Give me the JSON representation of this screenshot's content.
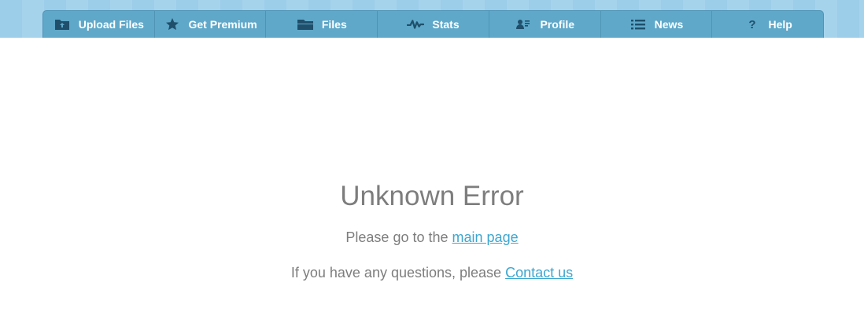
{
  "nav": {
    "items": [
      {
        "label": "Upload Files",
        "icon": "upload-folder-icon"
      },
      {
        "label": "Get Premium",
        "icon": "star-icon"
      },
      {
        "label": "Files",
        "icon": "folder-icon"
      },
      {
        "label": "Stats",
        "icon": "stats-wave-icon"
      },
      {
        "label": "Profile",
        "icon": "profile-card-icon"
      },
      {
        "label": "News",
        "icon": "list-icon"
      },
      {
        "label": "Help",
        "icon": "question-icon"
      }
    ]
  },
  "error": {
    "title": "Unknown Error",
    "line1_text": "Please go to the",
    "line1_link": "main page",
    "line2_text": "If you have any questions, please",
    "line2_link": "Contact us"
  },
  "colors": {
    "nav_bg": "#5fa8c9",
    "link": "#3ea6cf",
    "text": "#7d7d7d"
  }
}
